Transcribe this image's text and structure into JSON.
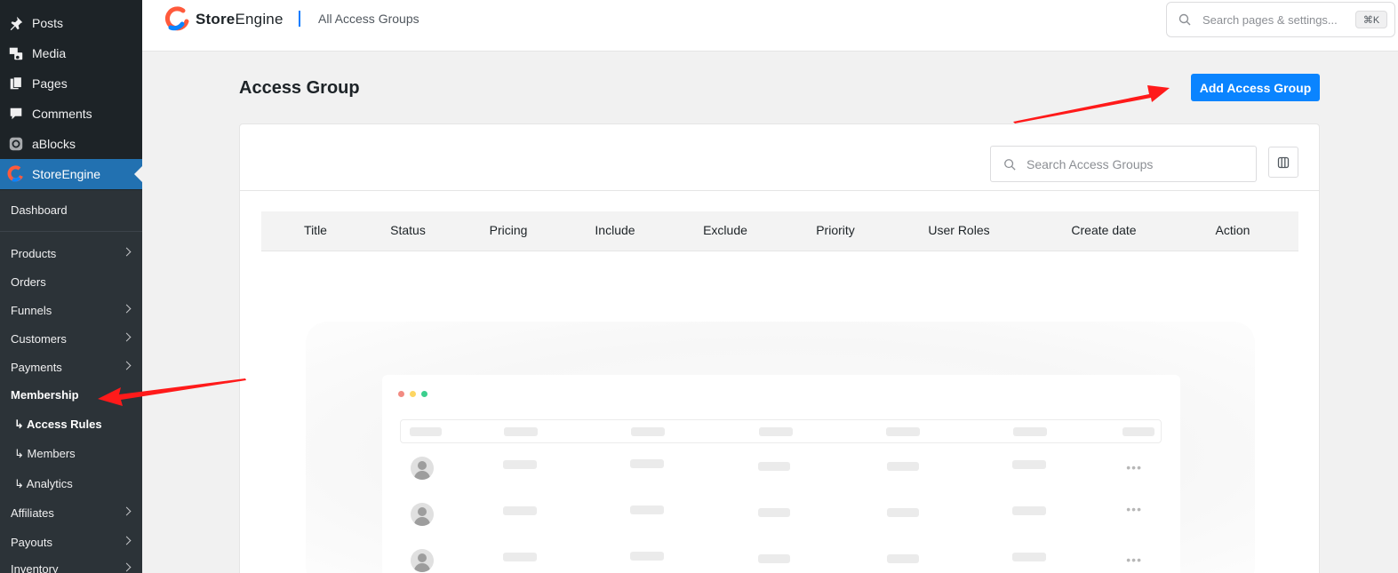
{
  "sidebar": {
    "top_items": [
      {
        "label": "Posts",
        "icon": "pin-icon"
      },
      {
        "label": "Media",
        "icon": "media-icon"
      },
      {
        "label": "Pages",
        "icon": "pages-icon"
      },
      {
        "label": "Comments",
        "icon": "comment-icon"
      },
      {
        "label": "aBlocks",
        "icon": "ablocks-icon"
      },
      {
        "label": "StoreEngine",
        "icon": "storeengine-icon",
        "active": true
      }
    ],
    "submenu": [
      {
        "label": "Dashboard"
      },
      {
        "label": "Products",
        "has_chevron": true
      },
      {
        "label": "Orders"
      },
      {
        "label": "Funnels",
        "has_chevron": true
      },
      {
        "label": "Customers",
        "has_chevron": true
      },
      {
        "label": "Payments",
        "has_chevron": true
      },
      {
        "label": "Membership",
        "bold": true
      },
      {
        "label": "↳ Access Rules",
        "bold": true
      },
      {
        "label": "↳ Members"
      },
      {
        "label": "↳ Analytics"
      },
      {
        "label": "Affiliates",
        "has_chevron": true
      },
      {
        "label": "Payouts",
        "has_chevron": true
      },
      {
        "label": "Inventory",
        "has_chevron": true
      }
    ]
  },
  "header": {
    "logo_text_bold": "Store",
    "logo_text_rest": "Engine",
    "breadcrumb": "All Access Groups",
    "search_placeholder": "Search pages & settings...",
    "search_shortcut": "⌘K"
  },
  "page": {
    "title": "Access Group",
    "add_button": "Add Access Group",
    "list_search_placeholder": "Search Access Groups",
    "columns": [
      "Title",
      "Status",
      "Pricing",
      "Include",
      "Exclude",
      "Priority",
      "User Roles",
      "Create date",
      "Action"
    ]
  },
  "colors": {
    "accent": "#0a84ff",
    "sidebar_bg": "#1d2327",
    "sidebar_active": "#2271b1",
    "annotation_arrow": "#ff1a1a",
    "window_dots": [
      "#f28b82",
      "#fdd663",
      "#3ccf8e"
    ]
  }
}
